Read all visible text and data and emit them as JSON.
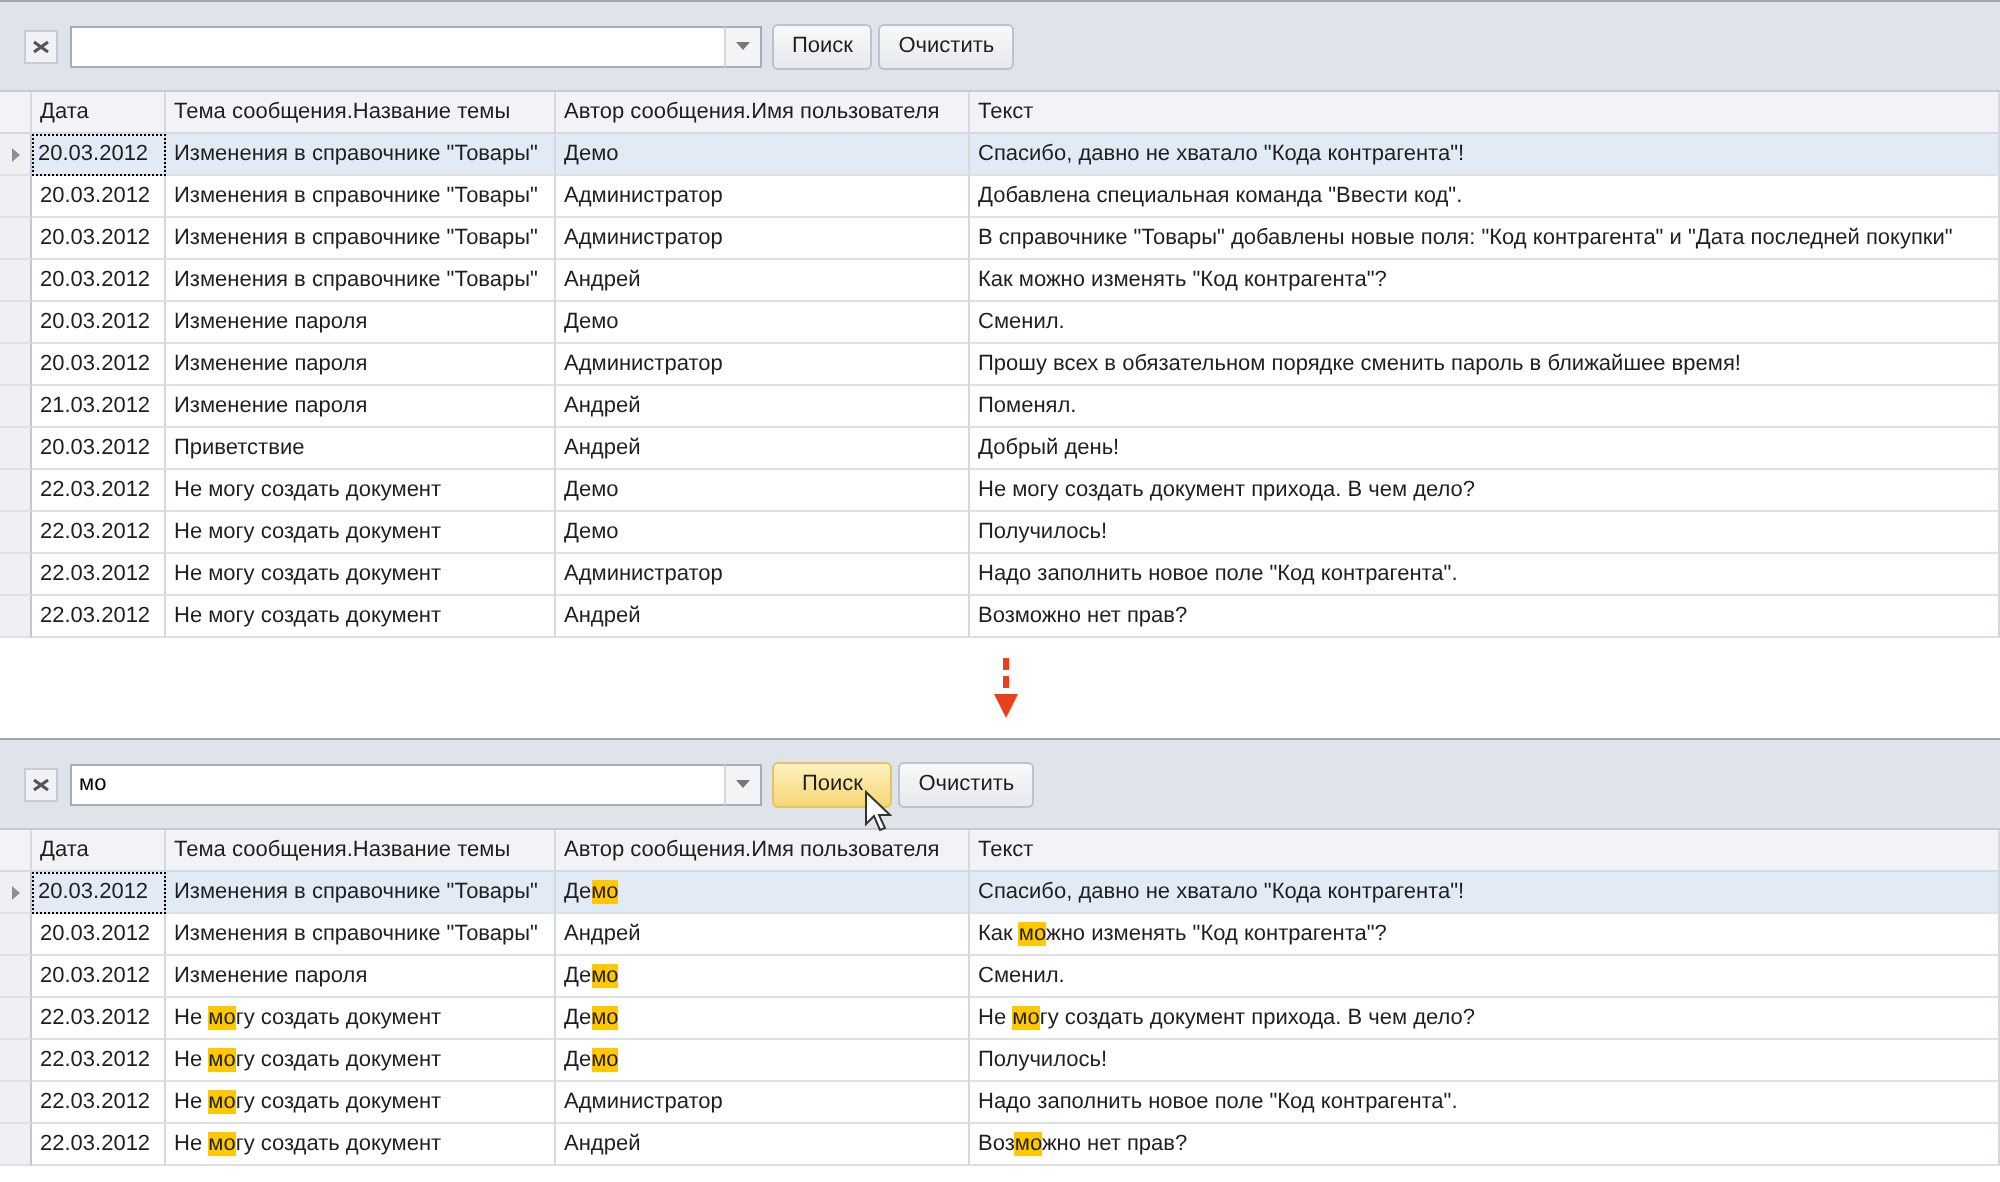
{
  "panels": [
    {
      "search": {
        "buttons": [
          {
            "label": "Поиск",
            "hovered": false
          },
          {
            "label": "Очистить",
            "hovered": false
          }
        ]
      },
      "table": {
        "columns": [
          "Дата",
          "Тема сообщения.Название темы",
          "Автор сообщения.Имя пользователя",
          "Текст"
        ],
        "rows": [
          {
            "selected": true,
            "cells": [
              "20.03.2012",
              "Изменения в справочнике \"Товары\"",
              "Демо",
              "Спасибо, давно не хватало \"Кода контрагента\"!"
            ]
          },
          {
            "selected": false,
            "cells": [
              "20.03.2012",
              "Изменения в справочнике \"Товары\"",
              "Администратор",
              "Добавлена специальная команда \"Ввести код\"."
            ]
          },
          {
            "selected": false,
            "cells": [
              "20.03.2012",
              "Изменения в справочнике \"Товары\"",
              "Администратор",
              "В справочнике \"Товары\" добавлены новые поля: \"Код контрагента\" и \"Дата последней покупки\""
            ]
          },
          {
            "selected": false,
            "cells": [
              "20.03.2012",
              "Изменения в справочнике \"Товары\"",
              "Андрей",
              "Как можно изменять \"Код контрагента\"?"
            ]
          },
          {
            "selected": false,
            "cells": [
              "20.03.2012",
              "Изменение пароля",
              "Демо",
              "Сменил."
            ]
          },
          {
            "selected": false,
            "cells": [
              "20.03.2012",
              "Изменение пароля",
              "Администратор",
              "Прошу всех в обязательном порядке сменить пароль в ближайшее время!"
            ]
          },
          {
            "selected": false,
            "cells": [
              "21.03.2012",
              "Изменение пароля",
              "Андрей",
              "Поменял."
            ]
          },
          {
            "selected": false,
            "cells": [
              "20.03.2012",
              "Приветствие",
              "Андрей",
              "Добрый день!"
            ]
          },
          {
            "selected": false,
            "cells": [
              "22.03.2012",
              "Не могу создать документ",
              "Демо",
              "Не могу создать документ прихода. В чем дело?"
            ]
          },
          {
            "selected": false,
            "cells": [
              "22.03.2012",
              "Не могу создать документ",
              "Демо",
              "Получилось!"
            ]
          },
          {
            "selected": false,
            "cells": [
              "22.03.2012",
              "Не могу создать документ",
              "Администратор",
              "Надо заполнить новое поле \"Код контрагента\"."
            ]
          },
          {
            "selected": false,
            "cells": [
              "22.03.2012",
              "Не могу создать документ",
              "Андрей",
              "Возможно нет прав?"
            ]
          }
        ]
      }
    },
    {
      "search": {
        "value": "мо",
        "buttons": [
          {
            "label": "Поиск",
            "hovered": true
          },
          {
            "label": "Очистить",
            "hovered": false
          }
        ]
      },
      "table": {
        "columns": [
          "Дата",
          "Тема сообщения.Название темы",
          "Автор сообщения.Имя пользователя",
          "Текст"
        ],
        "rows": [
          {
            "selected": true,
            "cells": [
              "20.03.2012",
              "Изменения в справочнике \"Товары\"",
              [
                {
                  "text": "Де",
                  "highlight": false
                },
                {
                  "text": "мо",
                  "highlight": true
                }
              ],
              "Спасибо, давно не хватало \"Кода контрагента\"!"
            ]
          },
          {
            "selected": false,
            "cells": [
              "20.03.2012",
              "Изменения в справочнике \"Товары\"",
              "Андрей",
              [
                {
                  "text": "Как ",
                  "highlight": false
                },
                {
                  "text": "мо",
                  "highlight": true
                },
                {
                  "text": "жно изменять \"Код контрагента\"?",
                  "highlight": false
                }
              ]
            ]
          },
          {
            "selected": false,
            "cells": [
              "20.03.2012",
              "Изменение пароля",
              [
                {
                  "text": "Де",
                  "highlight": false
                },
                {
                  "text": "мо",
                  "highlight": true
                }
              ],
              "Сменил."
            ]
          },
          {
            "selected": false,
            "cells": [
              "22.03.2012",
              [
                {
                  "text": "Не ",
                  "highlight": false
                },
                {
                  "text": "мо",
                  "highlight": true
                },
                {
                  "text": "гу создать документ",
                  "highlight": false
                }
              ],
              [
                {
                  "text": "Де",
                  "highlight": false
                },
                {
                  "text": "мо",
                  "highlight": true
                }
              ],
              [
                {
                  "text": "Не ",
                  "highlight": false
                },
                {
                  "text": "мо",
                  "highlight": true
                },
                {
                  "text": "гу создать документ прихода. В чем дело?",
                  "highlight": false
                }
              ]
            ]
          },
          {
            "selected": false,
            "cells": [
              "22.03.2012",
              [
                {
                  "text": "Не ",
                  "highlight": false
                },
                {
                  "text": "мо",
                  "highlight": true
                },
                {
                  "text": "гу создать документ",
                  "highlight": false
                }
              ],
              [
                {
                  "text": "Де",
                  "highlight": false
                },
                {
                  "text": "мо",
                  "highlight": true
                }
              ],
              "Получилось!"
            ]
          },
          {
            "selected": false,
            "cells": [
              "22.03.2012",
              [
                {
                  "text": "Не ",
                  "highlight": false
                },
                {
                  "text": "мо",
                  "highlight": true
                },
                {
                  "text": "гу создать документ",
                  "highlight": false
                }
              ],
              "Администратор",
              "Надо заполнить новое поле \"Код контрагента\"."
            ]
          },
          {
            "selected": false,
            "cells": [
              "22.03.2012",
              [
                {
                  "text": "Не ",
                  "highlight": false
                },
                {
                  "text": "мо",
                  "highlight": true
                },
                {
                  "text": "гу создать документ",
                  "highlight": false
                }
              ],
              "Андрей",
              [
                {
                  "text": "Воз",
                  "highlight": false
                },
                {
                  "text": "мо",
                  "highlight": true
                },
                {
                  "text": "жно нет прав?",
                  "highlight": false
                }
              ]
            ]
          }
        ]
      }
    }
  ]
}
